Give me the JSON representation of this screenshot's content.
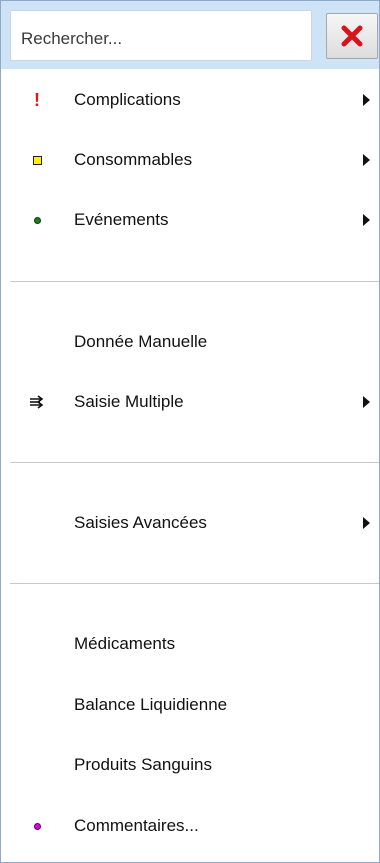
{
  "search": {
    "placeholder": "Rechercher..."
  },
  "close_icon": "close-icon",
  "items": [
    {
      "label": "Complications",
      "icon": "exclamation-icon",
      "color": "#e3141b",
      "has_submenu": true
    },
    {
      "label": "Consommables",
      "icon": "yellow-square-icon",
      "color": "#fff200",
      "has_submenu": true
    },
    {
      "label": "Evénements",
      "icon": "green-dot-icon",
      "color": "#1e7a1e",
      "has_submenu": true
    },
    {
      "label": "Donnée Manuelle",
      "icon": null,
      "has_submenu": false
    },
    {
      "label": "Saisie Multiple",
      "icon": "multiple-arrows-icon",
      "has_submenu": true
    },
    {
      "label": "Saisies Avancées",
      "icon": null,
      "has_submenu": true
    },
    {
      "label": "Médicaments",
      "icon": null,
      "has_submenu": false
    },
    {
      "label": "Balance Liquidienne",
      "icon": null,
      "has_submenu": false
    },
    {
      "label": "Produits Sanguins",
      "icon": null,
      "has_submenu": false
    },
    {
      "label": "Commentaires...",
      "icon": "magenta-dot-icon",
      "color": "#e000e0",
      "has_submenu": false
    }
  ]
}
